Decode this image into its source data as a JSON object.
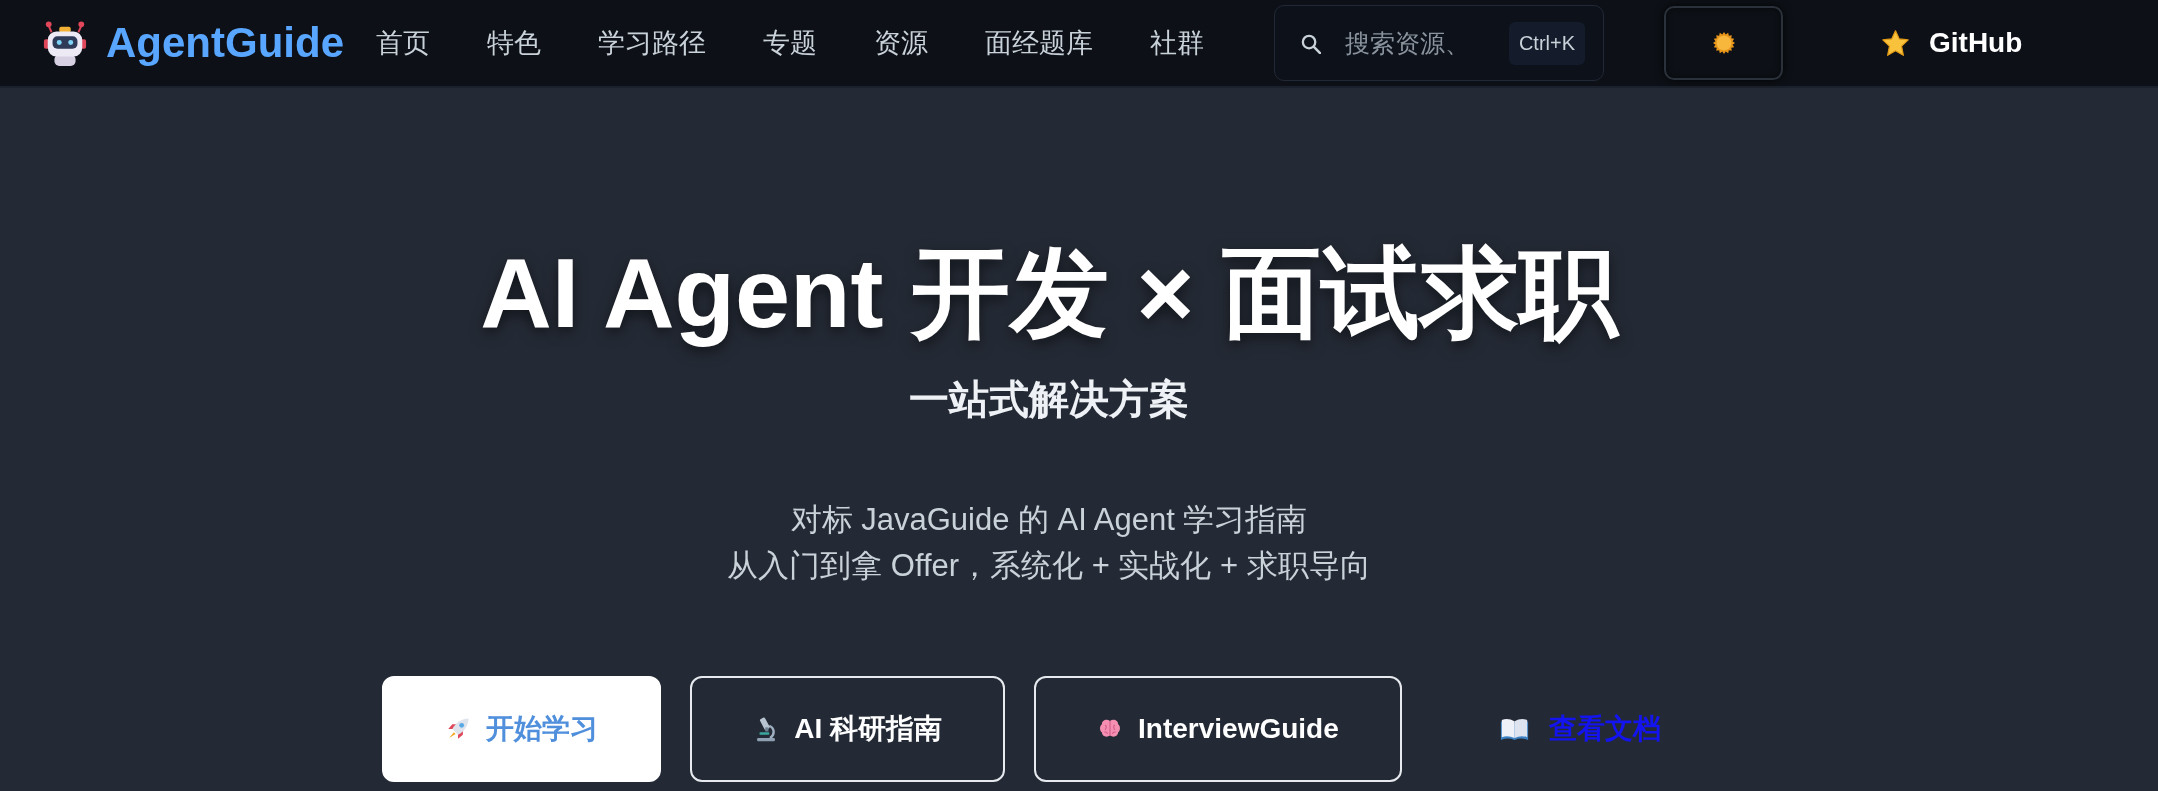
{
  "navbar": {
    "logo": "AgentGuide",
    "links": [
      {
        "label": "首页",
        "selected": false
      },
      {
        "label": "特色",
        "selected": false
      },
      {
        "label": "学习路径",
        "selected": false
      },
      {
        "label": "专题",
        "selected": false
      },
      {
        "label": "资源",
        "selected": false
      },
      {
        "label": "面经题库",
        "selected": false
      },
      {
        "label": "社群",
        "selected": false
      }
    ],
    "search": {
      "placeholder": "搜索资源、",
      "shortcut": "Ctrl+K"
    },
    "github": "GitHub"
  },
  "hero": {
    "title": "AI Agent 开发 × 面试求职",
    "subtitle": "一站式解决方案",
    "description": [
      "对标 JavaGuide 的 AI Agent 学习指南",
      "从入门到拿 Offer，系统化 + 实战化 + 求职导向"
    ],
    "actions": [
      {
        "kind": "primary",
        "label": "开始学习"
      },
      {
        "kind": "outline",
        "label": "AI 科研指南"
      },
      {
        "kind": "outline",
        "label": "InterviewGuide"
      },
      {
        "kind": "link",
        "label": "查看文档"
      }
    ]
  }
}
